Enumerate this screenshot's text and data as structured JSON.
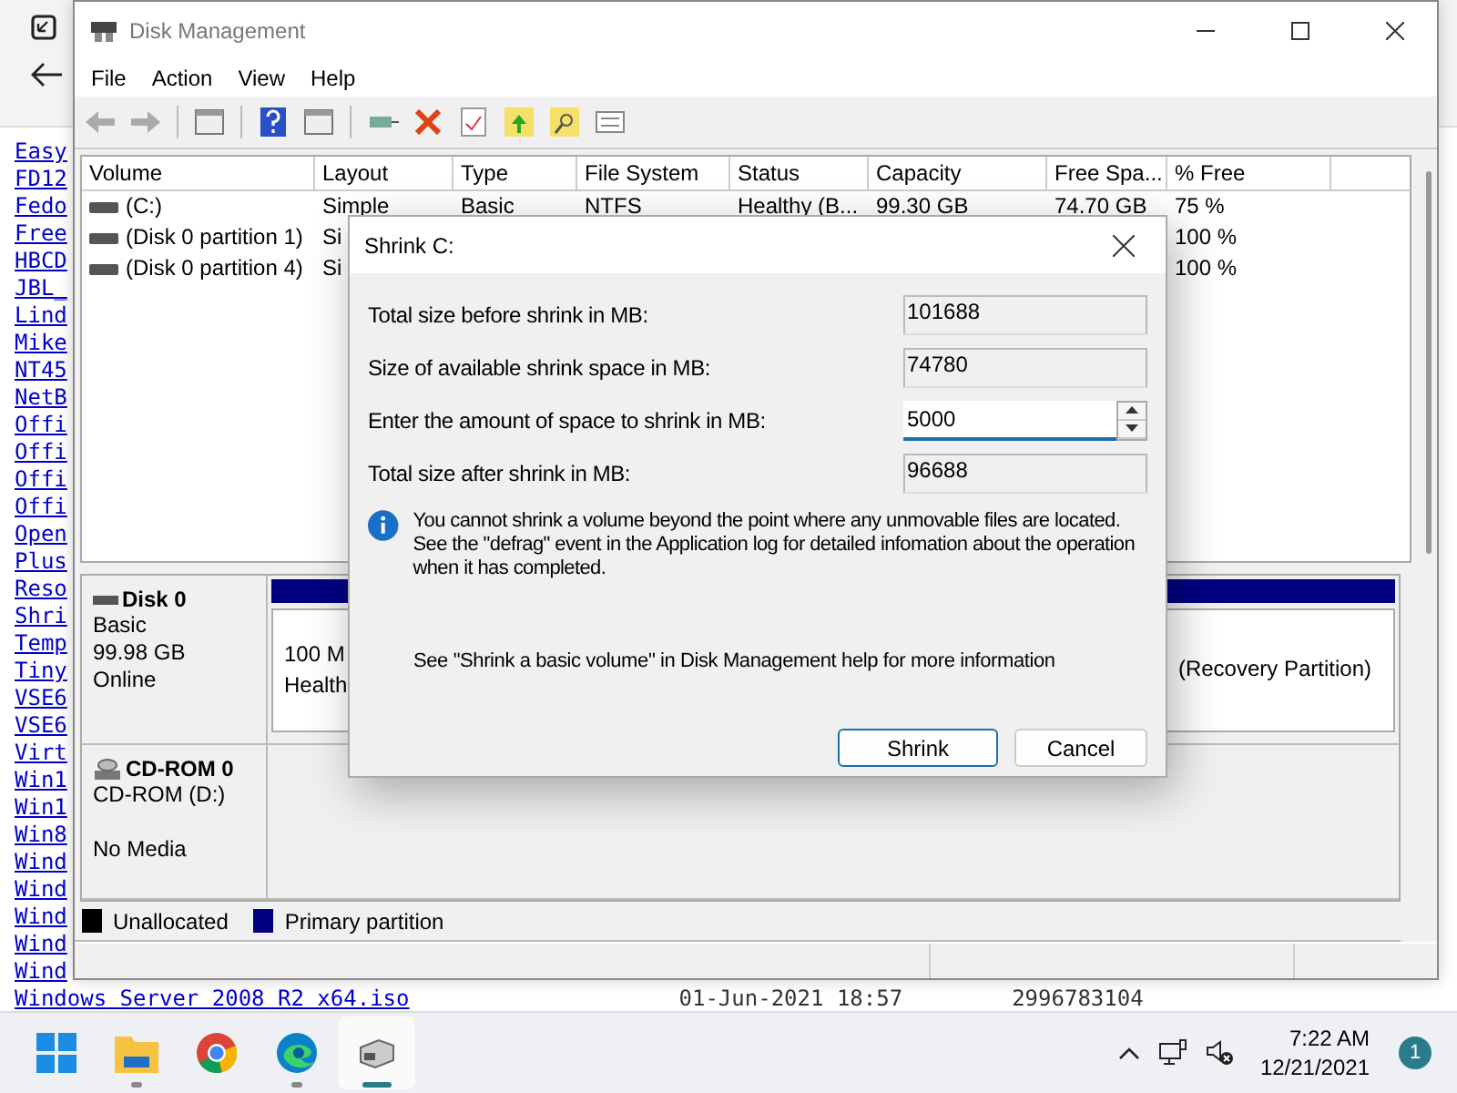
{
  "browser": {
    "links": [
      "Easy",
      "FD12",
      "Fedo",
      "Free",
      "HBCD",
      "JBL_",
      "Lind",
      "Mike",
      "NT45",
      "NetB",
      "Offi",
      "Offi",
      "Offi",
      "Offi",
      "Open",
      "Plus",
      "Reso",
      "Shri",
      "Temp",
      "Tiny",
      "VSE6",
      "VSE6",
      "Virt",
      "Win1",
      "Win1",
      "Win8",
      "Wind",
      "Wind",
      "Wind",
      "Wind",
      "Wind"
    ],
    "last_row": {
      "name": "Windows Server 2008 R2 x64.iso",
      "date": "01-Jun-2021 18:57",
      "size": "2996783104"
    }
  },
  "window": {
    "title": "Disk Management",
    "menu": [
      "File",
      "Action",
      "View",
      "Help"
    ],
    "columns": [
      "Volume",
      "Layout",
      "Type",
      "File System",
      "Status",
      "Capacity",
      "Free Spa...",
      "% Free"
    ],
    "rows": [
      {
        "cells": [
          "(C:)",
          "Simple",
          "Basic",
          "NTFS",
          "Healthy (B...",
          "99.30 GB",
          "74.70 GB"
        ],
        "free_pct": "75 %"
      },
      {
        "cells": [
          "(Disk 0 partition 1)",
          "Si"
        ],
        "free_pct": "100 %"
      },
      {
        "cells": [
          "(Disk 0 partition 4)",
          "Si"
        ],
        "free_pct": "100 %"
      }
    ],
    "disks": [
      {
        "kind": "disk",
        "name": "Disk 0",
        "lines": [
          "Basic",
          "99.98 GB",
          "Online"
        ],
        "partitions": [
          {
            "lines": [
              "100 M",
              "Health"
            ]
          },
          {
            "lines": [
              "(Recovery Partition)"
            ]
          }
        ]
      },
      {
        "kind": "cdrom",
        "name": "CD-ROM 0",
        "lines": [
          "CD-ROM (D:)",
          "No Media"
        ]
      }
    ],
    "legend": [
      {
        "label": "Unallocated",
        "color": "#000000"
      },
      {
        "label": "Primary partition",
        "color": "#000080"
      }
    ]
  },
  "dialog": {
    "title": "Shrink C:",
    "fields": [
      {
        "kind": "readonly",
        "label": "Total size before shrink in MB:",
        "value": "101688"
      },
      {
        "kind": "readonly",
        "label": "Size of available shrink space in MB:",
        "value": "74780"
      },
      {
        "kind": "spin",
        "label": "Enter the amount of space to shrink in MB:",
        "value": "5000"
      },
      {
        "kind": "readonly",
        "label": "Total size after shrink in MB:",
        "value": "96688"
      }
    ],
    "info": "You cannot shrink a volume beyond the point where any unmovable files are located. See the \"defrag\" event in the Application log for detailed infomation about the operation when it has completed.",
    "help": "See \"Shrink a basic volume\" in Disk Management help for more information",
    "buttons": [
      {
        "label": "Shrink",
        "default": true
      },
      {
        "label": "Cancel",
        "default": false
      }
    ]
  },
  "taskbar": {
    "apps": [
      {
        "kind": "start",
        "running": false,
        "active": false
      },
      {
        "kind": "folder",
        "running": true,
        "active": false
      },
      {
        "kind": "chrome",
        "running": false,
        "active": false
      },
      {
        "kind": "edge",
        "running": true,
        "active": false
      },
      {
        "kind": "disk",
        "running": true,
        "active": true
      }
    ],
    "time": "7:22 AM",
    "date": "12/21/2021",
    "badge": "1"
  }
}
